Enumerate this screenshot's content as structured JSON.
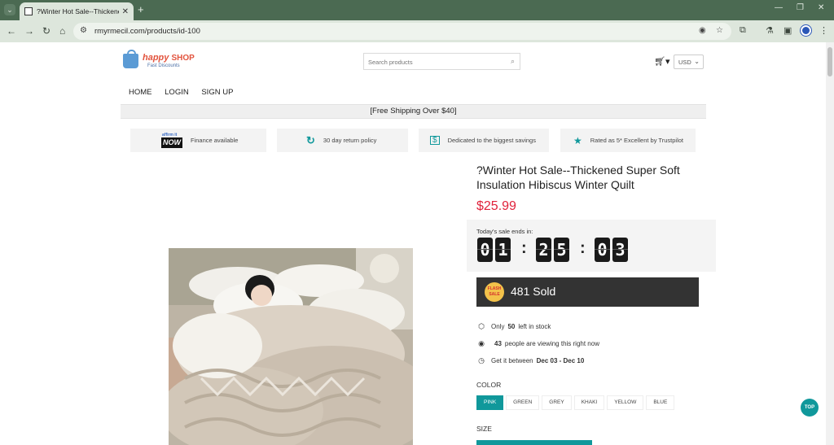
{
  "browser": {
    "tab_title": "?Winter Hot Sale--Thickened S",
    "tab_close": "✕",
    "new_tab": "+",
    "url": "rmyrmecil.com/products/id-100",
    "icons": [
      "back-icon",
      "forward-icon",
      "reload-icon",
      "home-icon",
      "site-settings-icon",
      "eye-off-icon",
      "bookmark-star-icon",
      "extensions-icon",
      "labs-icon",
      "sidebar-icon",
      "profile-icon",
      "menu-icon"
    ]
  },
  "store": {
    "logo_name": "happy",
    "logo_shop": "SHOP",
    "logo_tagline": "Fast Discounts",
    "search_placeholder": "Search products",
    "currency": "USD",
    "menu": [
      "HOME",
      "LOGIN",
      "SIGN UP"
    ],
    "shipping_banner": "[Free Shipping Over $40]",
    "features": [
      {
        "label": "Finance available",
        "icon": "affirm-now-logo"
      },
      {
        "label": "30 day return policy",
        "icon": "return-arrow-icon"
      },
      {
        "label": "Dedicated to the biggest savings",
        "icon": "cash-icon"
      },
      {
        "label": "Rated as 5* Excellent by Trustpilot",
        "icon": "star-icon"
      }
    ],
    "affirm_top": "affirm it",
    "affirm_now": "NOW"
  },
  "product": {
    "title": "?Winter Hot Sale--Thickened Super Soft Insulation Hibiscus Winter Quilt",
    "price": "$25.99",
    "sale_label": "Today's sale ends in:",
    "timer": {
      "h1": "0",
      "h2": "1",
      "m1": "2",
      "m2": "5",
      "s1": "0",
      "s2": "3"
    },
    "flash_badge": "FLASH SALE",
    "sold": "481 Sold",
    "stock": {
      "pre": "Only",
      "count": "50",
      "post": "left in stock"
    },
    "viewers": {
      "count": "43",
      "post": "people are viewing this right now"
    },
    "delivery": {
      "pre": "Get it between",
      "range": "Dec 03 - Dec 10"
    },
    "color_label": "COLOR",
    "colors": [
      "PINK",
      "GREEN",
      "GREY",
      "KHAKI",
      "YELLOW",
      "BLUE"
    ],
    "selected_color": "PINK",
    "size_label": "SIZE",
    "accent_color": "#10989b",
    "price_color": "#e0223b"
  },
  "top_button": "TOP"
}
